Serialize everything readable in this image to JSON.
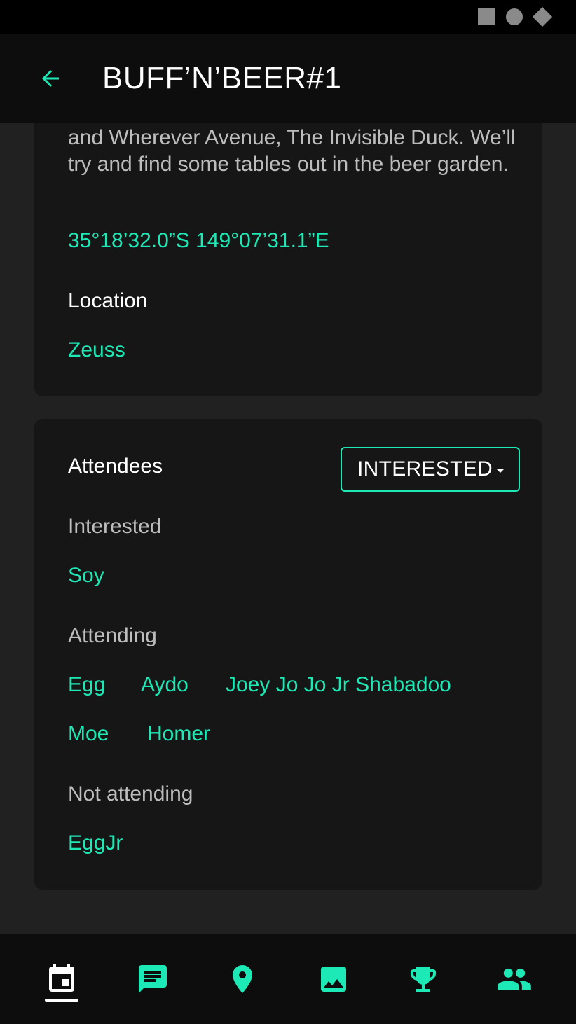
{
  "header": {
    "title": "BUFF’N’BEER#1"
  },
  "details": {
    "description": "and Wherever Avenue, The Invisible Duck. We’ll try and find some tables out in the beer garden.",
    "coordinates": "35°18’32.0”S 149°07’31.1”E",
    "location_heading": "Location",
    "location_value": "Zeuss"
  },
  "attendees": {
    "heading": "Attendees",
    "filter_selected": "INTERESTED",
    "groups": [
      {
        "label": "Interested",
        "names": [
          "Soy"
        ]
      },
      {
        "label": "Attending",
        "names": [
          "Egg",
          "Aydo",
          "Joey Jo Jo Jr Shabadoo",
          "Moe",
          "Homer"
        ]
      },
      {
        "label": "Not attending",
        "names": [
          "EggJr"
        ]
      }
    ]
  },
  "bottom_nav": {
    "items": [
      {
        "icon": "calendar-icon",
        "active": true
      },
      {
        "icon": "chat-icon",
        "active": false
      },
      {
        "icon": "location-pin-icon",
        "active": false
      },
      {
        "icon": "image-icon",
        "active": false
      },
      {
        "icon": "trophy-icon",
        "active": false
      },
      {
        "icon": "people-icon",
        "active": false
      }
    ]
  },
  "colors": {
    "accent": "#1de9b6",
    "card_bg": "#161616",
    "page_bg": "#212121",
    "bar_bg": "#0d0d0d"
  }
}
